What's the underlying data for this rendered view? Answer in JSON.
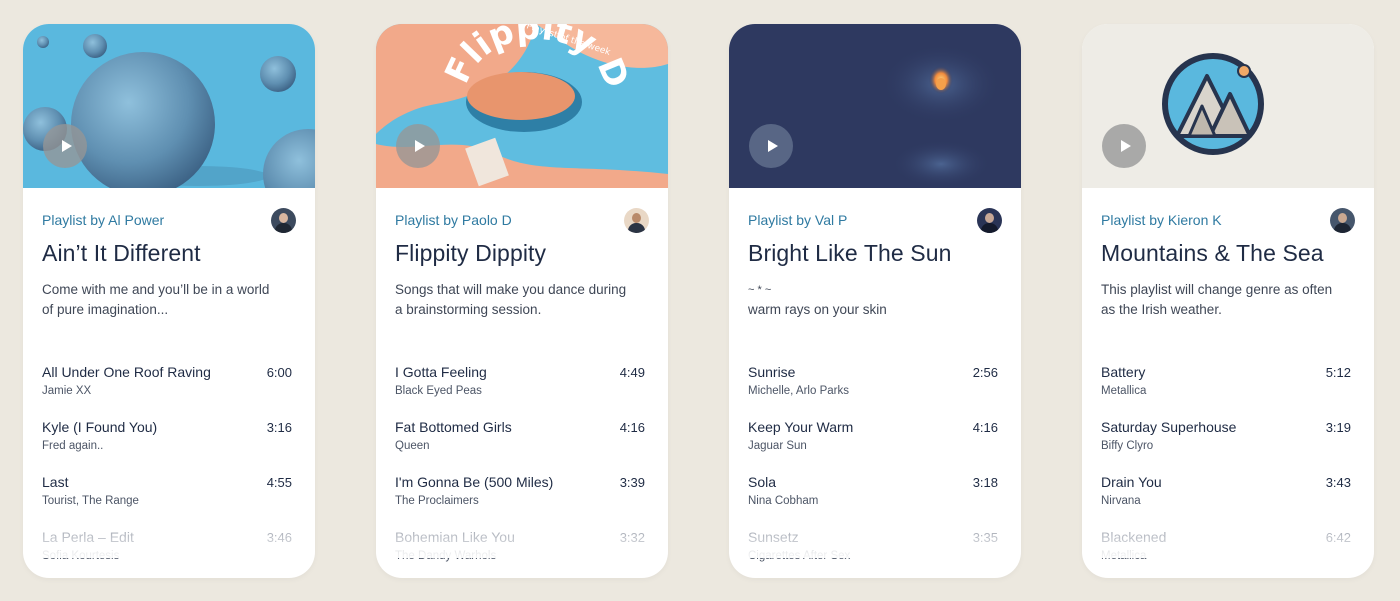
{
  "cards": [
    {
      "byline": "Playlist by Al Power",
      "title": "Ain’t It Different",
      "description": [
        "Come with me and you’ll be in a world",
        "of pure imagination..."
      ],
      "tracks": [
        {
          "name": "All Under One Roof Raving",
          "artist": "Jamie XX",
          "duration": "6:00"
        },
        {
          "name": "Kyle (I Found You)",
          "artist": "Fred again..",
          "duration": "3:16"
        },
        {
          "name": "Last",
          "artist": "Tourist, The Range",
          "duration": "4:55"
        },
        {
          "name": "La Perla – Edit",
          "artist": "Sofia Kourtesis",
          "duration": "3:46"
        }
      ]
    },
    {
      "byline": "Playlist by Paolo D",
      "title": "Flippity Dippity",
      "description": [
        "Songs that will make you dance during",
        "a brainstorming session."
      ],
      "cover_text": "Flippity Dippity",
      "cover_small_text": "Playlist of the week",
      "tracks": [
        {
          "name": "I Gotta Feeling",
          "artist": "Black Eyed Peas",
          "duration": "4:49"
        },
        {
          "name": "Fat Bottomed Girls",
          "artist": "Queen",
          "duration": "4:16"
        },
        {
          "name": "I'm Gonna Be (500 Miles)",
          "artist": "The Proclaimers",
          "duration": "3:39"
        },
        {
          "name": "Bohemian Like You",
          "artist": "The Dandy Warhols",
          "duration": "3:32"
        }
      ]
    },
    {
      "byline": "Playlist by Val P",
      "title": "Bright Like The Sun",
      "description": [
        "~ * ~",
        "warm rays on your skin"
      ],
      "tracks": [
        {
          "name": "Sunrise",
          "artist": "Michelle, Arlo Parks",
          "duration": "2:56"
        },
        {
          "name": "Keep Your Warm",
          "artist": "Jaguar Sun",
          "duration": "4:16"
        },
        {
          "name": "Sola",
          "artist": "Nina Cobham",
          "duration": "3:18"
        },
        {
          "name": "Sunsetz",
          "artist": "Cigarettes After Sex",
          "duration": "3:35"
        }
      ]
    },
    {
      "byline": "Playlist by Kieron K",
      "title": "Mountains & The Sea",
      "description": [
        "This playlist will change genre as often",
        "as the Irish weather."
      ],
      "tracks": [
        {
          "name": "Battery",
          "artist": "Metallica",
          "duration": "5:12"
        },
        {
          "name": "Saturday Superhouse",
          "artist": "Biffy Clyro",
          "duration": "3:19"
        },
        {
          "name": "Drain You",
          "artist": "Nirvana",
          "duration": "3:43"
        },
        {
          "name": "Blackened",
          "artist": "Metallica",
          "duration": "6:42"
        }
      ]
    }
  ],
  "colors": {
    "background": "#ece8df",
    "byline": "#2f7aa1",
    "title": "#1f2b44",
    "cover_blue": "#5ab8de",
    "cover_navy": "#2e3960",
    "cover_peach": "#f2a98a",
    "cover_light": "#eeece6"
  },
  "icons": [
    "play-icon",
    "avatar-icon",
    "mountain-logo-icon"
  ]
}
